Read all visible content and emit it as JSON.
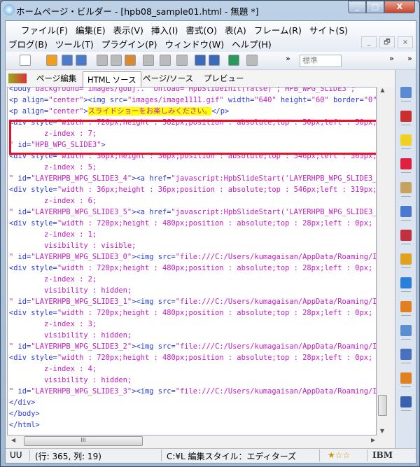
{
  "window": {
    "title": "ホームページ・ビルダー - [hpb08_sample01.html - 無題 *]",
    "min": "_",
    "max": "□",
    "close": "X"
  },
  "menu": {
    "row1": [
      "ファイル(F)",
      "編集(E)",
      "表示(V)",
      "挿入(I)",
      "書式(O)",
      "表(A)",
      "フレーム(R)",
      "サイト(S)"
    ],
    "row2": [
      "ブログ(B)",
      "ツール(T)",
      "プラグイン(P)",
      "ウィンドウ(W)",
      "ヘルプ(H)"
    ],
    "mdi": [
      "_",
      "🗗",
      "×"
    ]
  },
  "toolbar": {
    "style_select": "標準",
    "more": "»",
    "icons": [
      "new-document",
      "open-folder",
      "save",
      "save-all",
      "cut",
      "copy",
      "paste",
      "check",
      "undo",
      "redo",
      "publish",
      "upload",
      "site-view",
      "paragraph"
    ]
  },
  "tabs": [
    {
      "label": "ページ編集"
    },
    {
      "label": "HTML ソース",
      "active": true
    },
    {
      "label": "ページ/ソース"
    },
    {
      "label": "プレビュー"
    }
  ],
  "code": [
    [
      [
        "t",
        "<body "
      ],
      [
        "v",
        "background=\"images/gobj..\" onload=\"HpbSlideInit(false) ; HPB_WPG_SLIDE3\"; "
      ]
    ],
    [
      [
        "t",
        "<p align="
      ],
      [
        "v",
        "\"center\""
      ],
      [
        "t",
        ">"
      ],
      [
        "t",
        "<img src="
      ],
      [
        "v",
        "\"images/image1111.gif\""
      ],
      [
        "t",
        " width="
      ],
      [
        "v",
        "\"640\""
      ],
      [
        "t",
        " height="
      ],
      [
        "v",
        "\"60\""
      ],
      [
        "t",
        " border="
      ],
      [
        "v",
        "\"0\""
      ],
      [
        "t",
        " />"
      ]
    ],
    [
      [
        "t",
        "<p align="
      ],
      [
        "v",
        "\"center\""
      ],
      [
        "t",
        ">"
      ],
      [
        "h",
        "スライドショーをお楽しみください。"
      ],
      [
        "t",
        "</p>"
      ]
    ],
    [
      [
        "t",
        "<div style="
      ],
      [
        "v",
        "\"width : 720px;height : 582px;position : absolute;top : 50px;left : 50px;"
      ]
    ],
    [
      [
        "v",
        "        z-index : 7;"
      ]
    ],
    [
      [
        "v",
        "\""
      ],
      [
        "t",
        " id="
      ],
      [
        "v",
        "\"HPB_WPG_SLIDE3\""
      ],
      [
        "t",
        ">"
      ]
    ],
    [
      [
        "t",
        "<div style="
      ],
      [
        "v",
        "\"width : 36px;height : 36px;position : absolute;top : 546px;left : 365px;"
      ]
    ],
    [
      [
        "v",
        "        z-index : 5;"
      ]
    ],
    [
      [
        "v",
        "\""
      ],
      [
        "t",
        " id="
      ],
      [
        "v",
        "\"LAYERHPB_WPG_SLIDE3_4\""
      ],
      [
        "t",
        ">"
      ],
      [
        "t",
        "<a href="
      ],
      [
        "v",
        "\"javascript:HpbSlideStart('LAYERHPB_WPG_SLIDE3_3',"
      ]
    ],
    [
      [
        "t",
        "<div style="
      ],
      [
        "v",
        "\"width : 36px;height : 36px;position : absolute;top : 546px;left : 319px;"
      ]
    ],
    [
      [
        "v",
        "        z-index : 6;"
      ]
    ],
    [
      [
        "v",
        "\""
      ],
      [
        "t",
        " id="
      ],
      [
        "v",
        "\"LAYERHPB_WPG_SLIDE3_5\""
      ],
      [
        "t",
        ">"
      ],
      [
        "t",
        "<a href="
      ],
      [
        "v",
        "\"javascript:HpbSlideStart('LAYERHPB_WPG_SLIDE3_3',"
      ]
    ],
    [
      [
        "t",
        "<div style="
      ],
      [
        "v",
        "\"width : 720px;height : 480px;position : absolute;top : 28px;left : 0px;"
      ]
    ],
    [
      [
        "v",
        "        z-index : 1;"
      ]
    ],
    [
      [
        "v",
        "        visibility : visible;"
      ]
    ],
    [
      [
        "v",
        "\""
      ],
      [
        "t",
        " id="
      ],
      [
        "v",
        "\"LAYERHPB_WPG_SLIDE3_0\""
      ],
      [
        "t",
        ">"
      ],
      [
        "t",
        "<img src="
      ],
      [
        "v",
        "\"file:///C:/Users/kumagaisan/AppData/Roaming/IBM/"
      ]
    ],
    [
      [
        "t",
        "<div style="
      ],
      [
        "v",
        "\"width : 720px;height : 480px;position : absolute;top : 28px;left : 0px;"
      ]
    ],
    [
      [
        "v",
        "        z-index : 2;"
      ]
    ],
    [
      [
        "v",
        "        visibility : hidden;"
      ]
    ],
    [
      [
        "v",
        "\""
      ],
      [
        "t",
        " id="
      ],
      [
        "v",
        "\"LAYERHPB_WPG_SLIDE3_1\""
      ],
      [
        "t",
        ">"
      ],
      [
        "t",
        "<img src="
      ],
      [
        "v",
        "\"file:///C:/Users/kumagaisan/AppData/Roaming/IBM/"
      ]
    ],
    [
      [
        "t",
        "<div style="
      ],
      [
        "v",
        "\"width : 720px;height : 480px;position : absolute;top : 28px;left : 0px;"
      ]
    ],
    [
      [
        "v",
        "        z-index : 3;"
      ]
    ],
    [
      [
        "v",
        "        visibility : hidden;"
      ]
    ],
    [
      [
        "v",
        "\""
      ],
      [
        "t",
        " id="
      ],
      [
        "v",
        "\"LAYERHPB_WPG_SLIDE3_2\""
      ],
      [
        "t",
        ">"
      ],
      [
        "t",
        "<img src="
      ],
      [
        "v",
        "\"file:///C:/Users/kumagaisan/AppData/Roaming/IBM/"
      ]
    ],
    [
      [
        "t",
        "<div style="
      ],
      [
        "v",
        "\"width : 720px;height : 480px;position : absolute;top : 28px;left : 0px;"
      ]
    ],
    [
      [
        "v",
        "        z-index : 4;"
      ]
    ],
    [
      [
        "v",
        "        visibility : hidden;"
      ]
    ],
    [
      [
        "v",
        "\""
      ],
      [
        "t",
        " id="
      ],
      [
        "v",
        "\"LAYERHPB_WPG_SLIDE3_3\""
      ],
      [
        "t",
        ">"
      ],
      [
        "t",
        "<img src="
      ],
      [
        "v",
        "\"file:///C:/Users/kumagaisan/AppData/Roaming/IBM/"
      ]
    ],
    [
      [
        "t",
        "</div>"
      ]
    ],
    [
      [
        "t",
        "</body>"
      ]
    ],
    [
      [
        "t",
        "</html>"
      ]
    ]
  ],
  "hscroll_grip": "III",
  "status": {
    "encoding": "UU",
    "position": "(行: 365, 列: 19)",
    "edit_style": "C:¥L 編集スタイル：エディターズ",
    "rating": "★☆☆",
    "brand": "IBM"
  },
  "colors": {
    "tag": "#2a3cd8",
    "value": "#c020c0",
    "highlight": "#ffff00",
    "annotation_box": "#e8102a"
  },
  "right_panel_icons": [
    "page-list",
    "site-add",
    "folder",
    "help",
    "image-edit",
    "html-tag",
    "style-edit",
    "currency",
    "blog-b",
    "blog-orange",
    "site-settings",
    "list",
    "clipboard",
    "checkmark"
  ]
}
